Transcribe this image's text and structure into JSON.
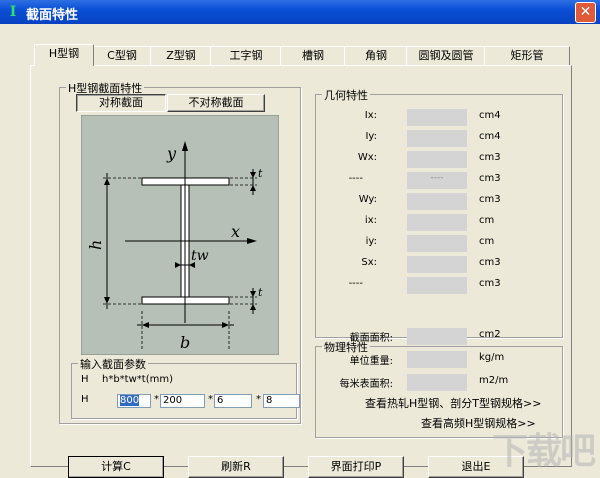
{
  "window": {
    "title": "截面特性",
    "title_icon": "I",
    "close_label": "✕"
  },
  "tabs": [
    "H型钢",
    "C型钢",
    "Z型钢",
    "工字钢",
    "槽钢",
    "角钢",
    "圆钢及圆管",
    "矩形管"
  ],
  "section": {
    "group_title": "H型钢截面特性",
    "symmetric_label": "对称截面",
    "asymmetric_label": "不对称截面",
    "diagram": {
      "y": "y",
      "x": "x",
      "h": "h",
      "b": "b",
      "tw": "tw",
      "t": "t"
    }
  },
  "params": {
    "group_title": "输入截面参数",
    "formula_prefix": "H",
    "formula": "h*b*tw*t(mm)",
    "row_prefix": "H",
    "h": "800",
    "b": "200",
    "tw": "6",
    "t": "8",
    "sep": "*"
  },
  "geometry": {
    "group_title": "几何特性",
    "rows": [
      {
        "label": "Ix:",
        "value": "",
        "unit": "cm4"
      },
      {
        "label": "Iy:",
        "value": "",
        "unit": "cm4"
      },
      {
        "label": "Wx:",
        "value": "",
        "unit": "cm3"
      },
      {
        "label": "----",
        "value": "----",
        "unit": "cm3"
      },
      {
        "label": "Wy:",
        "value": "",
        "unit": "cm3"
      },
      {
        "label": "ix:",
        "value": "",
        "unit": "cm"
      },
      {
        "label": "iy:",
        "value": "",
        "unit": "cm"
      },
      {
        "label": "Sx:",
        "value": "",
        "unit": "cm3"
      },
      {
        "label": "----",
        "value": "",
        "unit": "cm3"
      }
    ]
  },
  "physical": {
    "group_title": "物理特性",
    "rows": [
      {
        "label": "截面面积:",
        "value": "",
        "unit": "cm2"
      },
      {
        "label": "单位重量:",
        "value": "",
        "unit": "kg/m"
      },
      {
        "label": "每米表面积:",
        "value": "",
        "unit": "m2/m"
      }
    ],
    "link_hot_rolled": "查看热轧H型钢、剖分T型钢规格>>",
    "link_high_freq": "查看高频H型钢规格>>"
  },
  "buttons": {
    "calc": "计算C",
    "refresh": "刷新R",
    "print": "界面打印P",
    "exit": "退出E"
  },
  "watermark": "下载吧"
}
